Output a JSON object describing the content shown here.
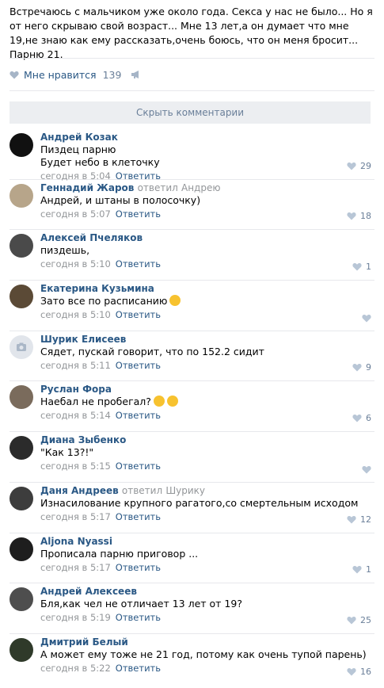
{
  "post": {
    "text": "Встречаюсь с мальчиком уже около года. Секса у нас не было... Но я от него скрываю свой возраст... Мне 13 лет,а он думает что мне 19,не знаю как ему рассказать,очень боюсь, что он меня бросит... Парню 21.",
    "like_label": "Мне нравится",
    "like_count": "139"
  },
  "hide_comments_label": "Скрыть комментарии",
  "comments": [
    {
      "author": "Андрей Козак",
      "replied": "",
      "replied_to": "",
      "text": [
        "Пиздец парню",
        "Будет небо в клеточку"
      ],
      "time": "сегодня в 5:04",
      "reply": "Ответить",
      "likes": "29",
      "avatar_color": "#111111"
    },
    {
      "author": "Геннадий Жаров",
      "replied": "ответил",
      "replied_to": "Андрею",
      "text": [
        "Андрей, и штаны в полосочку)"
      ],
      "time": "сегодня в 5:07",
      "reply": "Ответить",
      "likes": "18",
      "avatar_color": "#b7a58a"
    },
    {
      "author": "Алексей Пчеляков",
      "replied": "",
      "replied_to": "",
      "text": [
        "пиздешь,"
      ],
      "time": "сегодня в 5:10",
      "reply": "Ответить",
      "likes": "1",
      "avatar_color": "#4a4a4a"
    },
    {
      "author": "Екатерина Кузьмина",
      "replied": "",
      "replied_to": "",
      "text": [
        "Зато все по расписанию"
      ],
      "time": "сегодня в 5:10",
      "reply": "Ответить",
      "likes": "",
      "avatar_color": "#5b4a36"
    },
    {
      "author": "Шурик Елисеев",
      "replied": "",
      "replied_to": "",
      "text": [
        "Сядет, пускай говорит, что по 152.2 сидит"
      ],
      "time": "сегодня в 5:11",
      "reply": "Ответить",
      "likes": "9",
      "avatar_color": "#e1e5eb"
    },
    {
      "author": "Руслан Фора",
      "replied": "",
      "replied_to": "",
      "text": [
        "Наебал не пробегал?"
      ],
      "time": "сегодня в 5:14",
      "reply": "Ответить",
      "likes": "6",
      "avatar_color": "#7a6b5c"
    },
    {
      "author": "Диана Зыбенко",
      "replied": "",
      "replied_to": "",
      "text": [
        "\"Как 13?!\""
      ],
      "time": "сегодня в 5:15",
      "reply": "Ответить",
      "likes": "",
      "avatar_color": "#2b2b2b"
    },
    {
      "author": "Даня Андреев",
      "replied": "ответил",
      "replied_to": "Шурику",
      "text": [
        "Изнасилование крупного рагатого,со смертельным исходом"
      ],
      "time": "сегодня в 5:17",
      "reply": "Ответить",
      "likes": "12",
      "avatar_color": "#3d3d3d"
    },
    {
      "author": "Aljona Nyassi",
      "replied": "",
      "replied_to": "",
      "text": [
        "Прописала парню приговор ..."
      ],
      "time": "сегодня в 5:17",
      "reply": "Ответить",
      "likes": "1",
      "avatar_color": "#1e1e1e"
    },
    {
      "author": "Андрей Алексеев",
      "replied": "",
      "replied_to": "",
      "text": [
        "Бля,как чел не отличает 13 лет от 19?"
      ],
      "time": "сегодня в 5:19",
      "reply": "Ответить",
      "likes": "25",
      "avatar_color": "#4e4e4e"
    },
    {
      "author": "Дмитрий Белый",
      "replied": "",
      "replied_to": "",
      "text": [
        "А может ему тоже не 21 год, потому как очень тупой парень)"
      ],
      "time": "сегодня в 5:22",
      "reply": "Ответить",
      "likes": "16",
      "avatar_color": "#2f3a2a"
    }
  ]
}
